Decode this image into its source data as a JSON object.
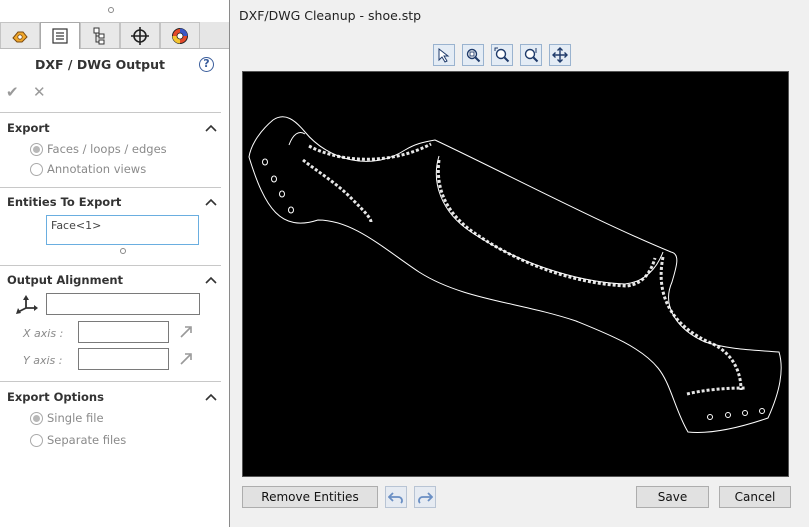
{
  "panel": {
    "title": "DXF / DWG Output",
    "tabs": [
      "feature-manager",
      "property-manager",
      "configuration-manager",
      "dimxpert-manager",
      "display-manager"
    ],
    "sections": {
      "export": {
        "title": "Export",
        "options": [
          "Faces / loops / edges",
          "Annotation views"
        ],
        "selected": "Faces / loops / edges"
      },
      "entities": {
        "title": "Entities To Export",
        "value": "Face<1>"
      },
      "alignment": {
        "title": "Output Alignment",
        "origin_value": "",
        "x_axis_label": "X axis :",
        "y_axis_label": "Y axis :",
        "x_axis_value": "",
        "y_axis_value": ""
      },
      "options": {
        "title": "Export Options",
        "options": [
          "Single file",
          "Separate files"
        ],
        "selected": "Single file"
      }
    }
  },
  "dialog": {
    "title": "DXF/DWG Cleanup - shoe.stp",
    "toolbar": [
      "select-tool-icon",
      "zoom-to-fit-icon",
      "zoom-to-area-icon",
      "zoom-in-out-icon",
      "pan-icon"
    ],
    "buttons": {
      "remove": "Remove Entities",
      "save": "Save",
      "cancel": "Cancel"
    }
  },
  "colors": {
    "accent": "#6aaee0",
    "canvas_bg": "#000000",
    "outline": "#ffffff"
  }
}
